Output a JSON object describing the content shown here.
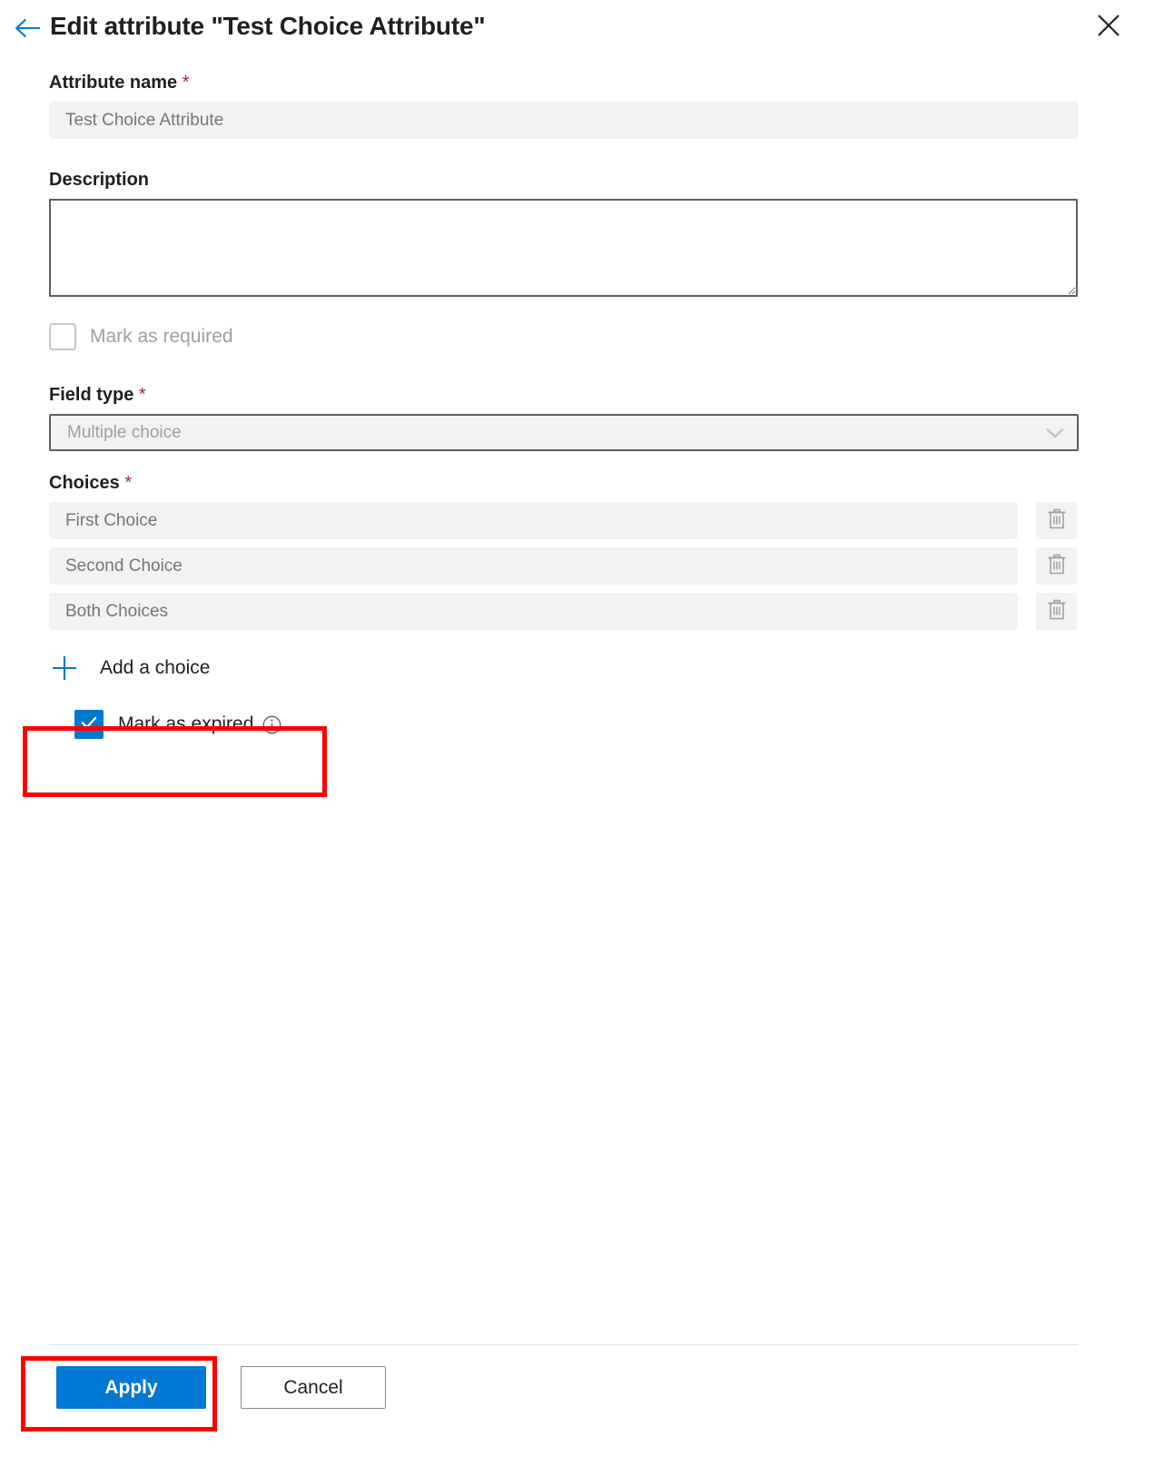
{
  "header": {
    "back_icon": "back-arrow-icon",
    "title": "Edit attribute \"Test Choice Attribute\"",
    "close_icon": "close-icon"
  },
  "form": {
    "attribute_name": {
      "label": "Attribute name",
      "required_marker": "*",
      "value": "",
      "placeholder": "Test Choice Attribute"
    },
    "description": {
      "label": "Description",
      "value": "",
      "placeholder": ""
    },
    "mark_as_required": {
      "label": "Mark as required",
      "checked": false,
      "disabled": true
    },
    "field_type": {
      "label": "Field type",
      "required_marker": "*",
      "selected": "Multiple choice",
      "chevron_icon": "chevron-down-icon",
      "options": [
        "Multiple choice"
      ]
    },
    "choices": {
      "label": "Choices",
      "required_marker": "*",
      "items": [
        {
          "placeholder": "First Choice",
          "value": "",
          "delete_icon": "trash-icon"
        },
        {
          "placeholder": "Second Choice",
          "value": "",
          "delete_icon": "trash-icon"
        },
        {
          "placeholder": "Both Choices",
          "value": "",
          "delete_icon": "trash-icon"
        }
      ],
      "add_label": "Add a choice",
      "add_icon": "plus-icon"
    },
    "mark_as_expired": {
      "label": "Mark as expired",
      "checked": true,
      "info_icon": "info-icon",
      "check_icon": "checkmark-icon"
    }
  },
  "footer": {
    "apply_label": "Apply",
    "cancel_label": "Cancel"
  },
  "colors": {
    "accent": "#0078d4",
    "required_star": "#a4262c",
    "annotation": "#ff0000",
    "input_background": "#f3f2f1",
    "border_strong": "#605e5c",
    "disabled_text": "#a19f9d"
  },
  "annotations": [
    {
      "name": "highlight-mark-as-expired",
      "color": "#ff0000"
    },
    {
      "name": "highlight-apply-button",
      "color": "#ff0000"
    }
  ]
}
